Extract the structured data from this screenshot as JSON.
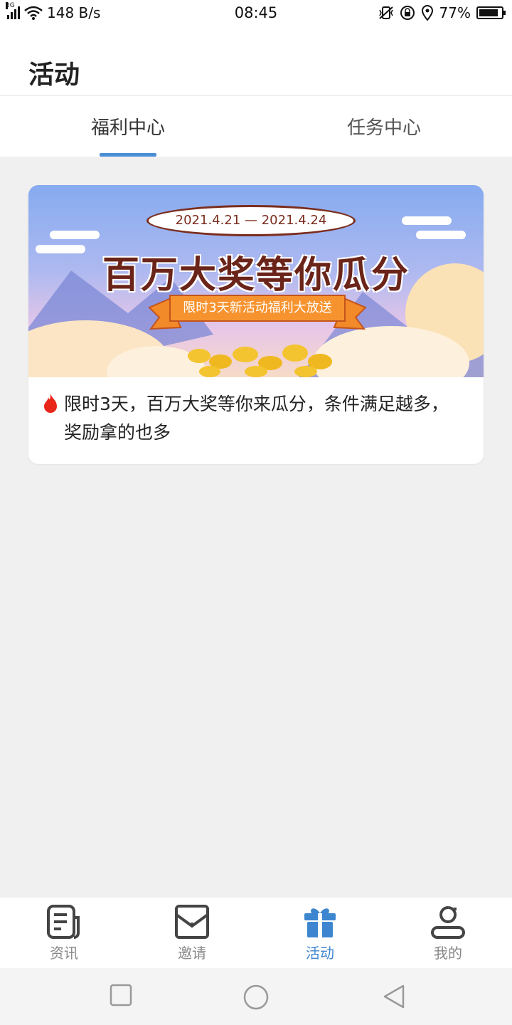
{
  "status_bar": {
    "network_type": "3G",
    "speed": "148 B/s",
    "time": "08:45",
    "battery": "77%",
    "battery_level": 0.77,
    "icons": [
      "signal-icon",
      "wifi-icon",
      "vibrate-icon",
      "rotation-lock-icon",
      "location-icon",
      "battery-icon"
    ]
  },
  "header": {
    "title": "活动"
  },
  "tabs": [
    {
      "label": "福利中心",
      "active": true
    },
    {
      "label": "任务中心",
      "active": false
    }
  ],
  "card": {
    "banner": {
      "date_range": "2021.4.21 — 2021.4.24",
      "title": "百万大奖等你瓜分",
      "ribbon_text": "限时3天新活动福利大放送"
    },
    "description": "限时3天，百万大奖等你来瓜分，条件满足越多，奖励拿的也多",
    "icon": "fire-icon"
  },
  "bottom_nav": [
    {
      "label": "资讯",
      "icon": "news-icon",
      "active": false
    },
    {
      "label": "邀请",
      "icon": "invite-envelope-icon",
      "active": false
    },
    {
      "label": "活动",
      "icon": "gift-icon",
      "active": true
    },
    {
      "label": "我的",
      "icon": "profile-icon",
      "active": false
    }
  ],
  "colors": {
    "accent": "#4a8ed6",
    "active_nav": "#3d86cf",
    "ribbon": "#f7932f",
    "title_text": "#6b2419"
  }
}
